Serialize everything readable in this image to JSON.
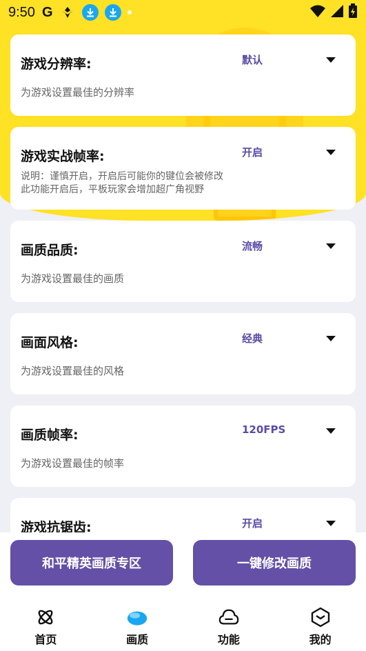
{
  "status_bar": {
    "time": "9:50",
    "g_letter": "G"
  },
  "cards": [
    {
      "title": "游戏分辨率:",
      "value": "默认",
      "desc": "为游戏设置最佳的分辨率"
    },
    {
      "title": "游戏实战帧率:",
      "value": "开启",
      "desc": "说明：谨慎开启，开启后可能你的键位会被修改",
      "desc2": "此功能开启后，平板玩家会增加超广角视野"
    },
    {
      "title": "画质品质:",
      "value": "流畅",
      "desc": "为游戏设置最佳的画质"
    },
    {
      "title": "画面风格:",
      "value": "经典",
      "desc": "为游戏设置最佳的风格"
    },
    {
      "title": "画质帧率:",
      "value": "120FPS",
      "desc": "为游戏设置最佳的帧率"
    },
    {
      "title": "游戏抗锯齿:",
      "value": "开启",
      "desc": ""
    }
  ],
  "actions": {
    "left_label": "和平精英画质专区",
    "right_label": "一键修改画质"
  },
  "nav": [
    {
      "label": "首页",
      "icon": "atom-icon"
    },
    {
      "label": "画质",
      "icon": "cloud-blue-icon"
    },
    {
      "label": "功能",
      "icon": "cloud-outline-icon"
    },
    {
      "label": "我的",
      "icon": "cube-icon"
    }
  ],
  "colors": {
    "accent": "#6450a6",
    "yellow": "#ffe125",
    "value_text": "#5b4ba6"
  }
}
